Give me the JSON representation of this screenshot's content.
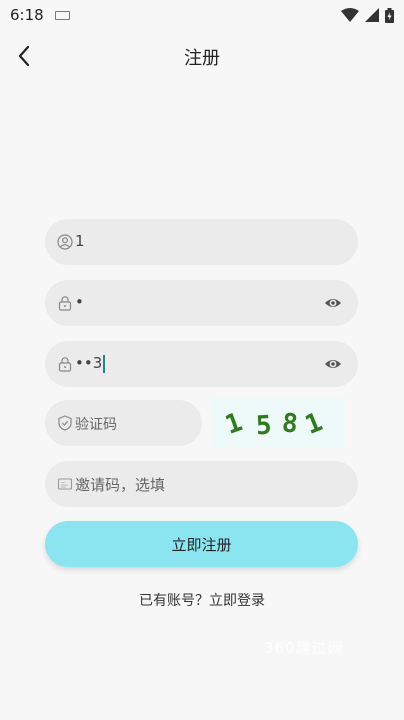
{
  "status": {
    "time": "6:18"
  },
  "header": {
    "title": "注册"
  },
  "form": {
    "username": {
      "value": "1"
    },
    "password": {
      "value": "•"
    },
    "confirm_password": {
      "value": "••3"
    },
    "captcha": {
      "placeholder": "验证码",
      "image_text": "1581"
    },
    "invite": {
      "placeholder": "邀请码，选填"
    }
  },
  "submit_label": "立即注册",
  "login_link": "已有账号？立即登录",
  "watermark": "360趣过网",
  "colors": {
    "accent": "#8be5f0",
    "captcha_text": "#2e7d1a",
    "cursor": "#1a8a85"
  }
}
